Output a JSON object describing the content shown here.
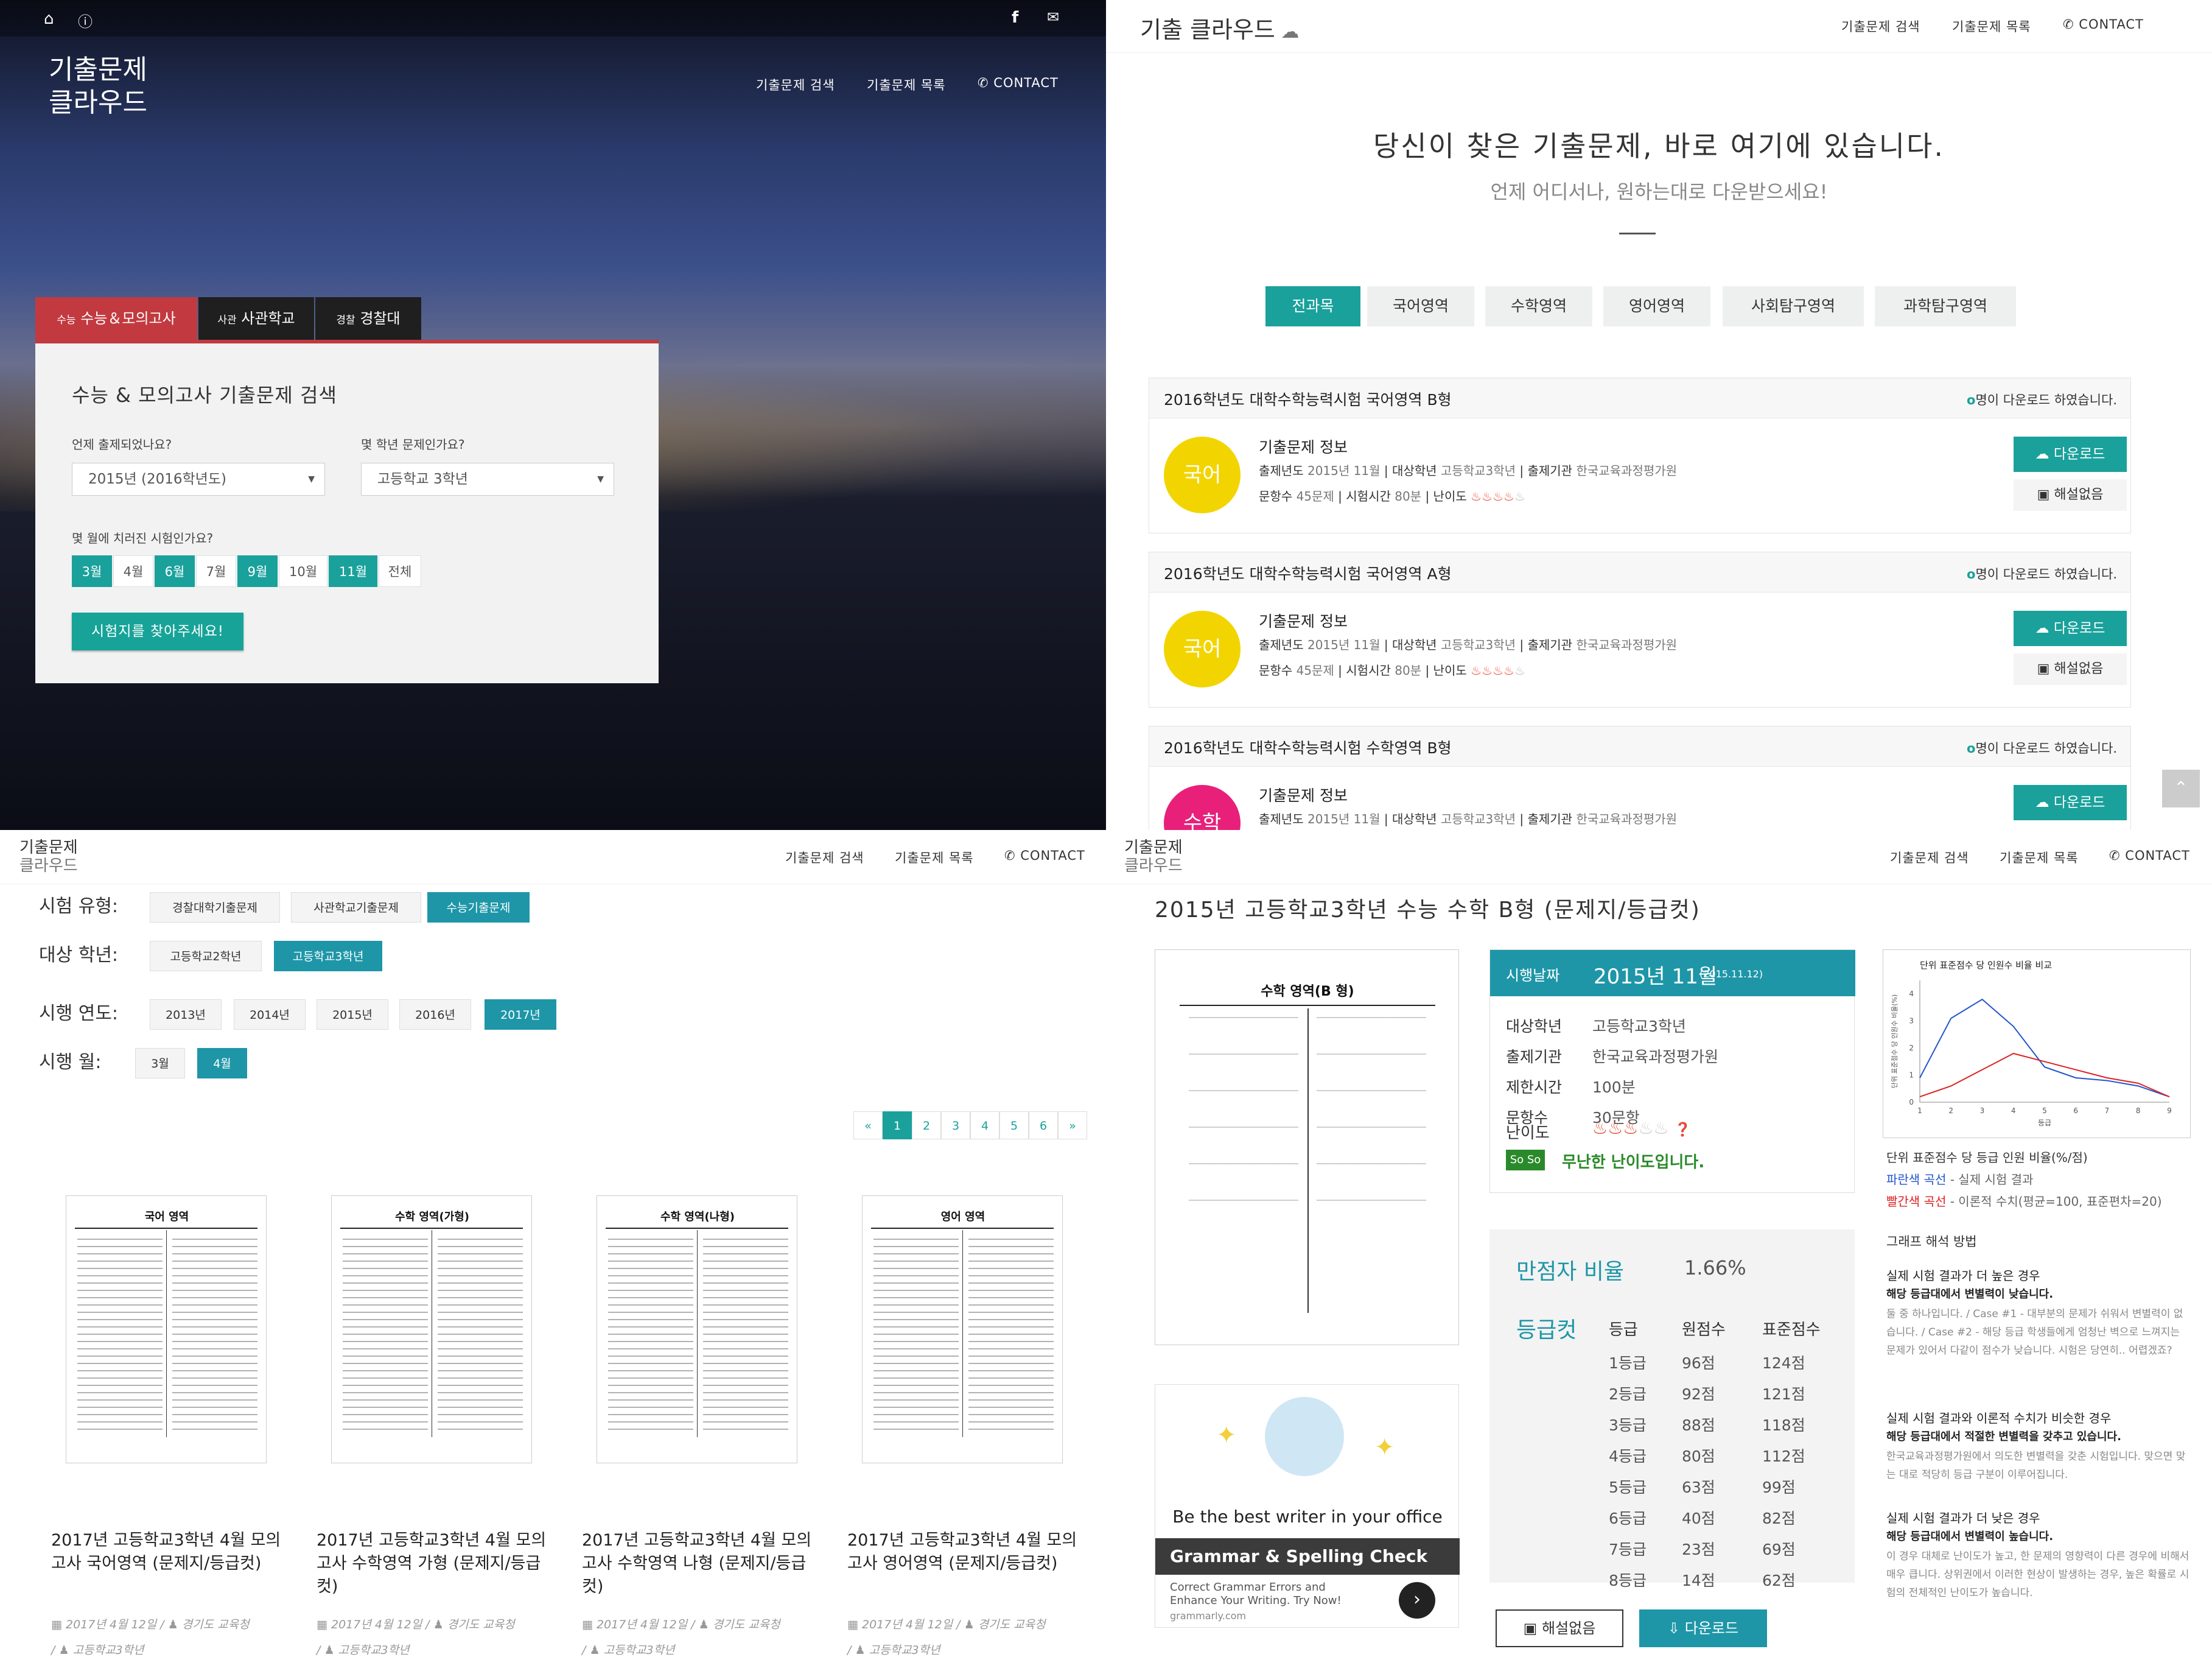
{
  "q1": {
    "logo_line1": "기출문제",
    "logo_line2": "클라우드",
    "nav": [
      "기출문제 검색",
      "기출문제 목록",
      "CONTACT"
    ],
    "tabs": [
      {
        "tag": "수능",
        "label": "수능＆모의고사"
      },
      {
        "tag": "사관",
        "label": "사관학교"
      },
      {
        "tag": "경찰",
        "label": "경찰대"
      }
    ],
    "panel_title": "수능 & 모의고사 기출문제 검색",
    "q_when": "언제 출제되었나요?",
    "q_grade": "몇 학년 문제인가요?",
    "select_year": "2015년 (2016학년도)",
    "select_grade": "고등학교 3학년",
    "q_month": "몇 월에 치러진 시험인가요?",
    "months": [
      {
        "label": "3월",
        "on": true
      },
      {
        "label": "4월",
        "on": false
      },
      {
        "label": "6월",
        "on": true
      },
      {
        "label": "7월",
        "on": false
      },
      {
        "label": "9월",
        "on": true
      },
      {
        "label": "10월",
        "on": false
      },
      {
        "label": "11월",
        "on": true
      },
      {
        "label": "전체",
        "on": false
      }
    ],
    "search_btn": "시험지를 찾아주세요!"
  },
  "q2": {
    "logo": "기출 클라우드",
    "nav": [
      "기출문제 검색",
      "기출문제 목록",
      "CONTACT"
    ],
    "hero_title": "당신이 찾은 기출문제, 바로 여기에 있습니다.",
    "hero_sub": "언제 어디서나, 원하는대로 다운받으세요!",
    "categories": [
      "전과목",
      "국어영역",
      "수학영역",
      "영어영역",
      "사회탐구영역",
      "과학탐구영역"
    ],
    "cards": [
      {
        "title": "2016학년도 대학수학능력시험 국어영역 B형",
        "dl": "명이 다운로드 하였습니다.",
        "subject": "국어",
        "info": "기출문제 정보",
        "year_lbl": "출제년도",
        "year": "2015년 11월",
        "target_lbl": "대상학년",
        "target": "고등학교3학년",
        "org_lbl": "출제기관",
        "org": "한국교육과정평가원",
        "count_lbl": "문항수",
        "count": "45문제",
        "time_lbl": "시험시간",
        "time": "80분",
        "diff_lbl": "난이도",
        "download": "다운로드",
        "solution": "해설없음",
        "color": "#f2d500"
      },
      {
        "title": "2016학년도 대학수학능력시험 국어영역 A형",
        "dl": "명이 다운로드 하였습니다.",
        "subject": "국어",
        "info": "기출문제 정보",
        "year_lbl": "출제년도",
        "year": "2015년 11월",
        "target_lbl": "대상학년",
        "target": "고등학교3학년",
        "org_lbl": "출제기관",
        "org": "한국교육과정평가원",
        "count_lbl": "문항수",
        "count": "45문제",
        "time_lbl": "시험시간",
        "time": "80분",
        "diff_lbl": "난이도",
        "download": "다운로드",
        "solution": "해설없음",
        "color": "#f2d500"
      },
      {
        "title": "2016학년도 대학수학능력시험 수학영역 B형",
        "dl": "명이 다운로드 하였습니다.",
        "subject": "수학",
        "info": "기출문제 정보",
        "year_lbl": "출제년도",
        "year": "2015년 11월",
        "target_lbl": "대상학년",
        "target": "고등학교3학년",
        "org_lbl": "출제기관",
        "org": "한국교육과정평가원",
        "download": "다운로드",
        "color": "#e8207a"
      }
    ]
  },
  "q3": {
    "logo_line1": "기출문제",
    "logo_line2": "클라우드",
    "nav": [
      "기출문제 검색",
      "기출문제 목록",
      "CONTACT"
    ],
    "filters": [
      {
        "label": "시험 유형:",
        "opts": [
          {
            "t": "경찰대학기출문제",
            "on": false
          },
          {
            "t": "사관학교기출문제",
            "on": false
          },
          {
            "t": "수능기출문제",
            "on": true
          }
        ]
      },
      {
        "label": "대상 학년:",
        "opts": [
          {
            "t": "고등학교2학년",
            "on": false
          },
          {
            "t": "고등학교3학년",
            "on": true
          }
        ]
      },
      {
        "label": "시행 연도:",
        "opts": [
          {
            "t": "2013년",
            "on": false
          },
          {
            "t": "2014년",
            "on": false
          },
          {
            "t": "2015년",
            "on": false
          },
          {
            "t": "2016년",
            "on": false
          },
          {
            "t": "2017년",
            "on": true
          }
        ]
      },
      {
        "label": "시행 월:",
        "opts": [
          {
            "t": "3월",
            "on": false
          },
          {
            "t": "4월",
            "on": true
          }
        ]
      }
    ],
    "pages": [
      "«",
      "1",
      "2",
      "3",
      "4",
      "5",
      "6",
      "»"
    ],
    "items": [
      {
        "doc_title": "국어 영역",
        "title": "2017년 고등학교3학년 4월 모의고사 국어영역 (문제지/등급컷)",
        "date": "2017년 4월 12일",
        "org": "경기도 교육청",
        "grade": "고등학교3학년"
      },
      {
        "doc_title": "수학 영역(가형)",
        "title": "2017년 고등학교3학년 4월 모의고사 수학영역 가형 (문제지/등급컷)",
        "date": "2017년 4월 12일",
        "org": "경기도 교육청",
        "grade": "고등학교3학년"
      },
      {
        "doc_title": "수학 영역(나형)",
        "title": "2017년 고등학교3학년 4월 모의고사 수학영역 나형 (문제지/등급컷)",
        "date": "2017년 4월 12일",
        "org": "경기도 교육청",
        "grade": "고등학교3학년"
      },
      {
        "doc_title": "영어 영역",
        "title": "2017년 고등학교3학년 4월 모의고사 영어영역 (문제지/등급컷)",
        "date": "2017년 4월 12일",
        "org": "경기도 교육청",
        "grade": "고등학교3학년"
      }
    ]
  },
  "q4": {
    "logo_line1": "기출문제",
    "logo_line2": "클라우드",
    "nav": [
      "기출문제 검색",
      "기출문제 목록",
      "CONTACT"
    ],
    "title": "2015년 고등학교3학년 수능 수학 B형 (문제지/등급컷)",
    "doc_title": "수학 영역(B 형)",
    "ad_headline": "Be the best writer in your office",
    "ad_title": "Grammar & Spelling Check",
    "ad_text1": "Correct Grammar Errors and",
    "ad_text2": "Enhance Your Writing. Try Now!",
    "ad_url": "grammarly.com",
    "exam_date_lbl": "시행날짜",
    "exam_date": "2015년 11월",
    "exam_date_small": "(2015.11.12)",
    "rows": [
      {
        "k": "대상학년",
        "v": "고등학교3학년"
      },
      {
        "k": "출제기관",
        "v": "한국교육과정평가원"
      },
      {
        "k": "제한시간",
        "v": "100분"
      },
      {
        "k": "문항수",
        "v": "30문항"
      }
    ],
    "diff_lbl": "난이도",
    "soso": "So So",
    "diff_text": "무난한 난이도입니다.",
    "perfect_lbl": "만점자 비율",
    "perfect": "1.66%",
    "cut_lbl": "등급컷",
    "cut_headers": [
      "등급",
      "원점수",
      "표준점수"
    ],
    "cut_rows": [
      [
        "1등급",
        "96점",
        "124점"
      ],
      [
        "2등급",
        "92점",
        "121점"
      ],
      [
        "3등급",
        "88점",
        "118점"
      ],
      [
        "4등급",
        "80점",
        "112점"
      ],
      [
        "5등급",
        "63점",
        "99점"
      ],
      [
        "6등급",
        "40점",
        "82점"
      ],
      [
        "7등급",
        "23점",
        "69점"
      ],
      [
        "8등급",
        "14점",
        "62점"
      ]
    ],
    "btn_solution": "해설없음",
    "btn_download": "다운로드",
    "side_title": "단위 표준점수 당 등급 인원 비율(%/점)",
    "blue_lbl": "파란색 곡선",
    "blue_txt": " - 실제 시험 결과",
    "red_lbl": "빨간색 곡선",
    "red_txt": " - 이론적 수치(평균=100, 표준편차=20)",
    "guide_title": "그래프 해석 방법",
    "guide": [
      {
        "h": "실제 시험 결과가 더 높은 경우",
        "b": "해당 등급대에서 변별력이 낮습니다.",
        "t": "둘 중 하나입니다. / Case #1 - 대부분의 문제가 쉬워서 변별력이 없습니다. / Case #2 - 해당 등급 학생들에게 엄청난 벽으로 느껴지는 문제가 있어서 다같이 점수가 낮습니다. 시험은 당연히.. 어렵겠죠?"
      },
      {
        "h": "실제 시험 결과와 이론적 수치가 비슷한 경우",
        "b": "해당 등급대에서 적절한 변별력을 갖추고 있습니다.",
        "t": "한국교육과정평가원에서 의도한 변별력을 갖춘 시험입니다. 맞으면 맞는 대로 적당히 등급 구분이 이루어집니다."
      },
      {
        "h": "실제 시험 결과가 더 낮은 경우",
        "b": "해당 등급대에서 변별력이 높습니다.",
        "t": "이 경우 대체로 난이도가 높고, 한 문제의 영향력이 다른 경우에 비해서 매우 큽니다. 상위권에서 이러한 현상이 발생하는 경우, 높은 확률로 시험의 전체적인 난이도가 높습니다."
      }
    ],
    "chart_data": {
      "type": "line",
      "title": "단위 표준점수 당 인원수 비율 비교",
      "xlabel": "등급",
      "ylabel": "단위 표준점수 당 인원수 비율(%)",
      "x": [
        1,
        2,
        3,
        4,
        5,
        6,
        7,
        8,
        9
      ],
      "ylim": [
        0,
        4.5
      ],
      "yticks": [
        0,
        1,
        2,
        3,
        4
      ],
      "series": [
        {
          "color": "#2255cc",
          "values": [
            0.9,
            3.1,
            3.8,
            2.8,
            1.3,
            0.9,
            0.8,
            0.6,
            0.2
          ]
        },
        {
          "color": "#dd2222",
          "values": [
            0.2,
            0.6,
            1.2,
            1.8,
            1.5,
            1.2,
            0.9,
            0.7,
            0.2
          ]
        }
      ]
    }
  }
}
